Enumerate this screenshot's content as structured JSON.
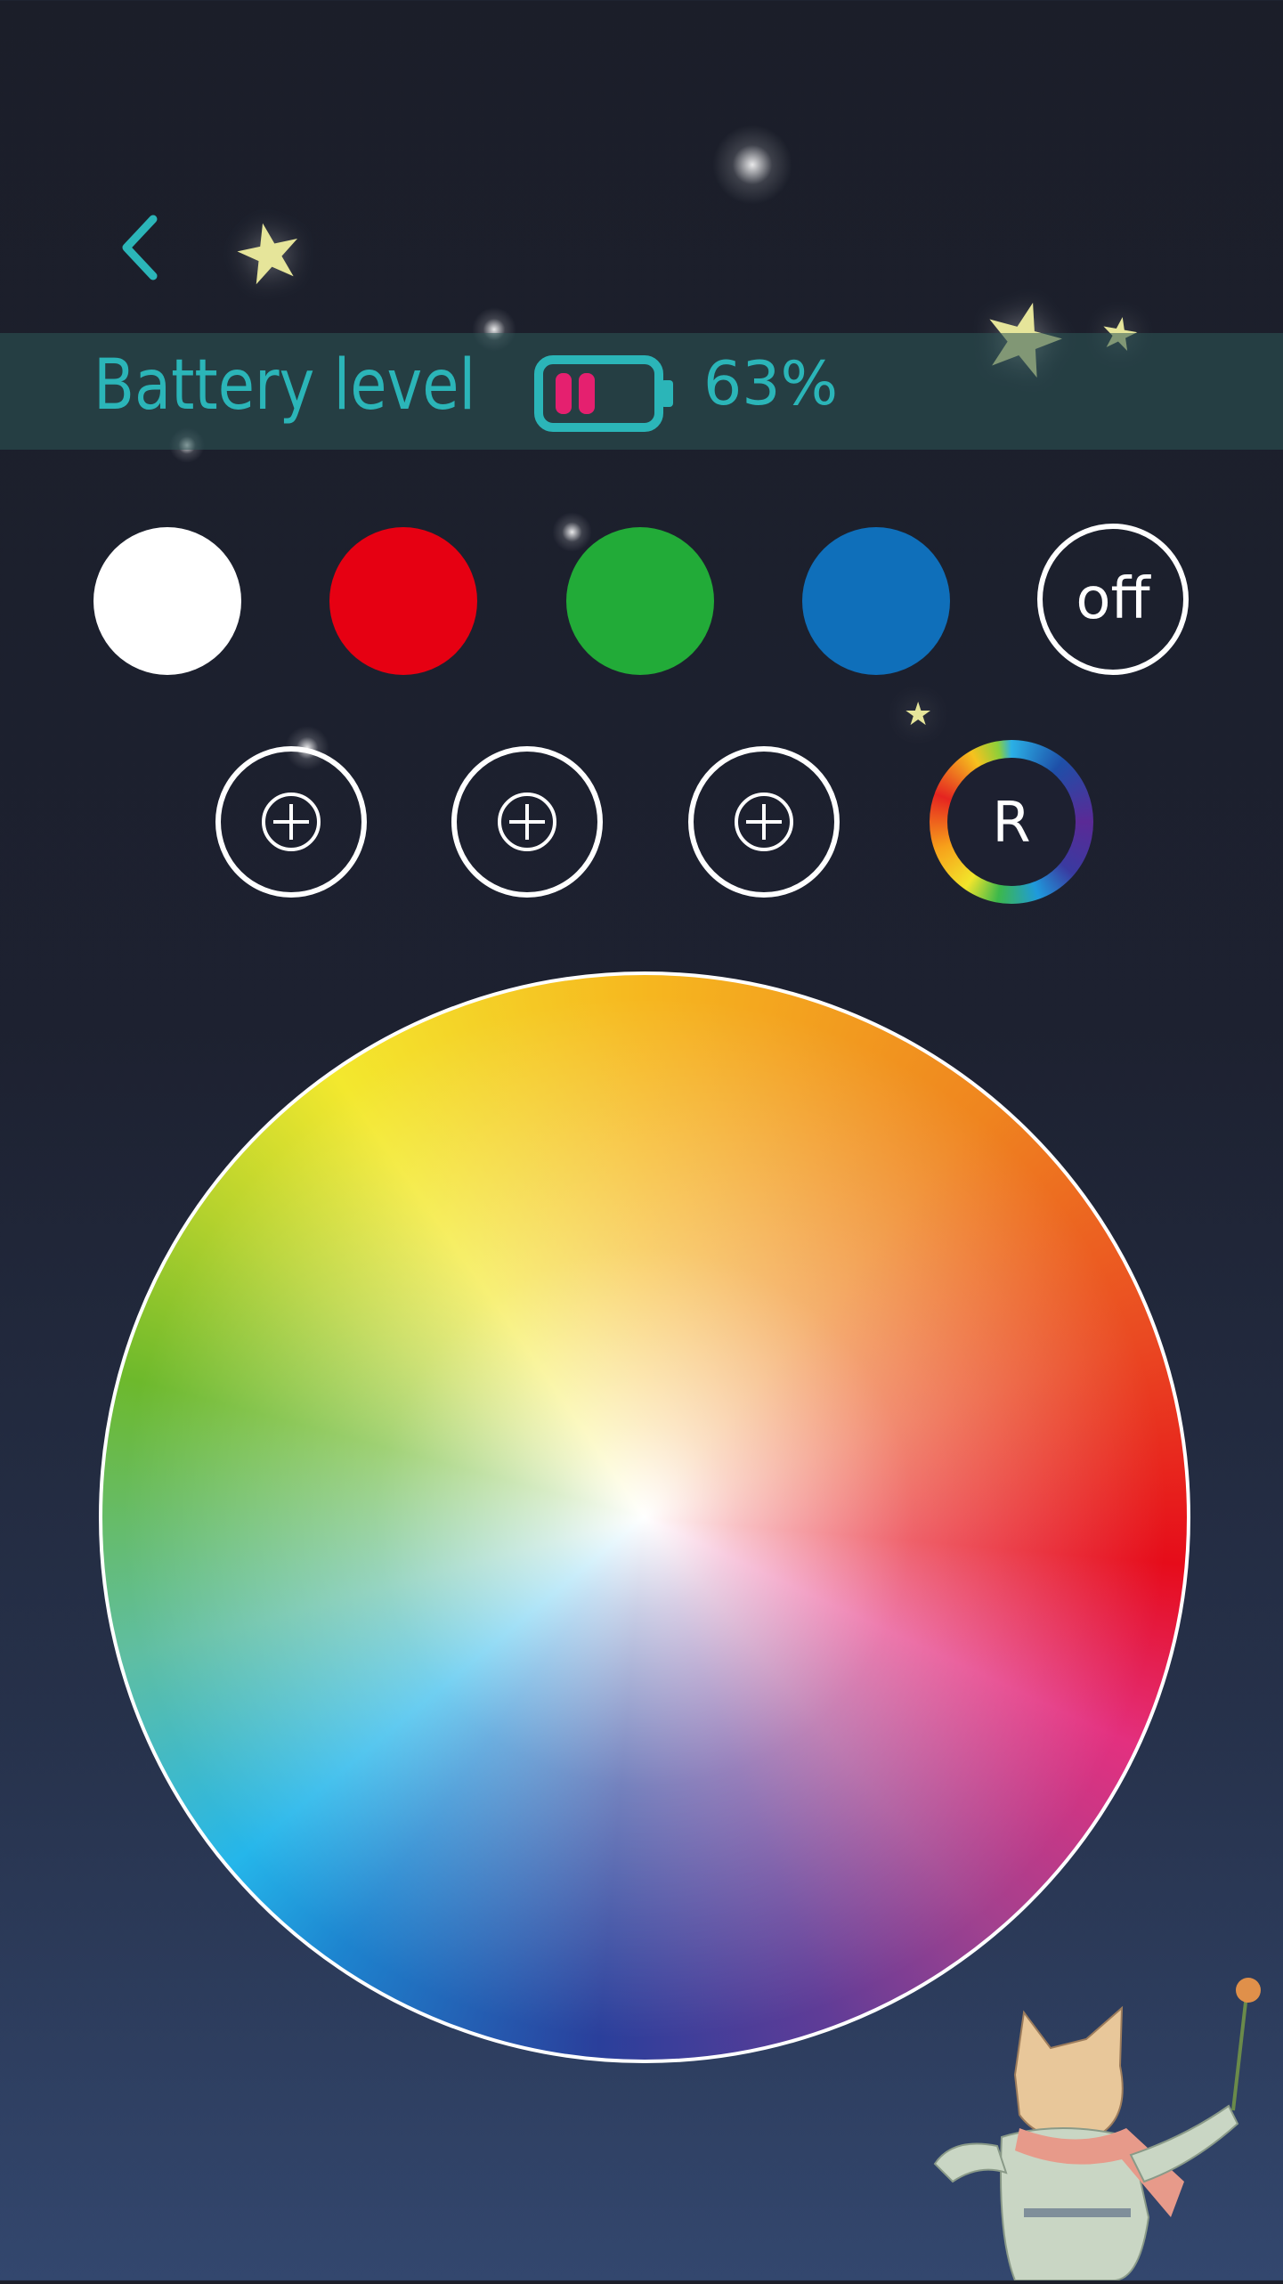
{
  "header": {
    "back_icon": "chevron-left-icon"
  },
  "battery": {
    "label": "Battery level",
    "percent_text": "63%",
    "level_percent": 63,
    "icon": "battery-icon",
    "fill_color": "#e5206f",
    "accent_color": "#2bb5b8"
  },
  "swatches": [
    {
      "name": "white",
      "color": "#ffffff"
    },
    {
      "name": "red",
      "color": "#e60012"
    },
    {
      "name": "green",
      "color": "#22ab38"
    },
    {
      "name": "blue",
      "color": "#0f6fba"
    }
  ],
  "off_button": {
    "label": "off"
  },
  "custom_slots": [
    {
      "icon": "plus-circle-icon"
    },
    {
      "icon": "plus-circle-icon"
    },
    {
      "icon": "plus-circle-icon"
    }
  ],
  "rainbow_button": {
    "label": "R"
  },
  "color_wheel": {
    "icon": "color-wheel"
  }
}
